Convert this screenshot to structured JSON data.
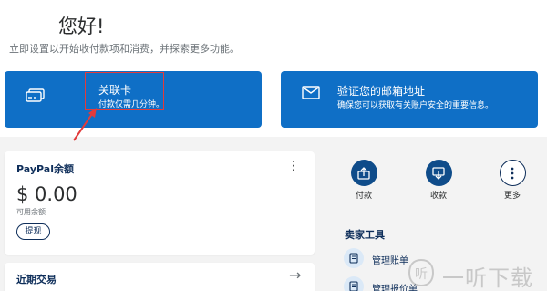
{
  "header": {
    "greeting": "您好!",
    "subtitle": "立即设置以开始收付款项和消费，并探索更多功能。"
  },
  "cards": {
    "link_card": {
      "title": "关联卡",
      "desc": "付款仅需几分钟。",
      "icon": "credit-card-icon"
    },
    "verify_email": {
      "title": "验证您的邮箱地址",
      "desc": "确保您可以获取有关账户安全的重要信息。",
      "icon": "envelope-icon"
    }
  },
  "balance": {
    "title": "PayPal余额",
    "menu": "⋮",
    "amount": "$ 0.00",
    "sub": "可用余额",
    "withdraw": "提现"
  },
  "recent": {
    "title": "近期交易",
    "arrow": "→"
  },
  "actions": [
    {
      "label": "付款",
      "icon": "send-money-icon"
    },
    {
      "label": "收款",
      "icon": "request-money-icon"
    },
    {
      "label": "更多",
      "icon": "more-dots-icon"
    }
  ],
  "seller_tools": {
    "title": "卖家工具",
    "items": [
      {
        "label": "管理账单",
        "icon": "invoice-icon"
      },
      {
        "label": "管理报价单",
        "icon": "quote-icon"
      }
    ]
  },
  "colors": {
    "primary_blue": "#0f6fc6",
    "navy": "#0e2e5a",
    "annotation_red": "#e23b3b"
  },
  "watermark": {
    "text": "一听下载",
    "logo_glyph": "听"
  }
}
